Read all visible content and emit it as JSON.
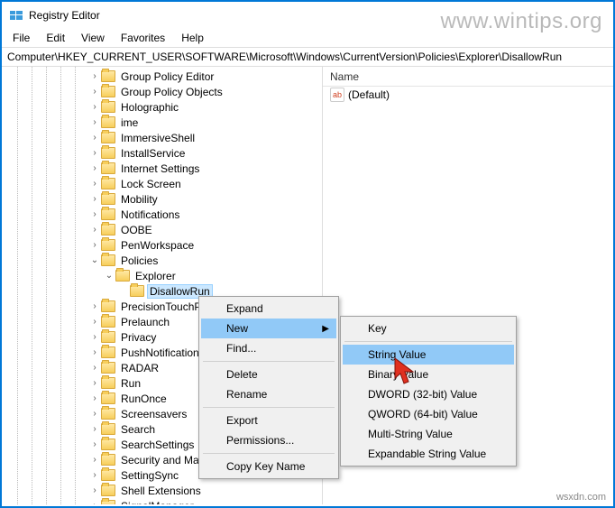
{
  "window": {
    "title": "Registry Editor"
  },
  "menu": {
    "file": "File",
    "edit": "Edit",
    "view": "View",
    "favorites": "Favorites",
    "help": "Help"
  },
  "address": {
    "path": "Computer\\HKEY_CURRENT_USER\\SOFTWARE\\Microsoft\\Windows\\CurrentVersion\\Policies\\Explorer\\DisallowRun"
  },
  "list": {
    "header_name": "Name",
    "default_value": "(Default)"
  },
  "tree": {
    "items": [
      {
        "label": "Group Policy Editor",
        "depth": 6,
        "chev": ">"
      },
      {
        "label": "Group Policy Objects",
        "depth": 6,
        "chev": ">"
      },
      {
        "label": "Holographic",
        "depth": 6,
        "chev": ">"
      },
      {
        "label": "ime",
        "depth": 6,
        "chev": ">"
      },
      {
        "label": "ImmersiveShell",
        "depth": 6,
        "chev": ">"
      },
      {
        "label": "InstallService",
        "depth": 6,
        "chev": ">"
      },
      {
        "label": "Internet Settings",
        "depth": 6,
        "chev": ">"
      },
      {
        "label": "Lock Screen",
        "depth": 6,
        "chev": ">"
      },
      {
        "label": "Mobility",
        "depth": 6,
        "chev": ">"
      },
      {
        "label": "Notifications",
        "depth": 6,
        "chev": ">"
      },
      {
        "label": "OOBE",
        "depth": 6,
        "chev": ">"
      },
      {
        "label": "PenWorkspace",
        "depth": 6,
        "chev": ">"
      },
      {
        "label": "Policies",
        "depth": 6,
        "chev": "v"
      },
      {
        "label": "Explorer",
        "depth": 7,
        "chev": "v"
      },
      {
        "label": "DisallowRun",
        "depth": 8,
        "chev": "",
        "selected": true
      },
      {
        "label": "PrecisionTouchPad",
        "depth": 6,
        "chev": ">"
      },
      {
        "label": "Prelaunch",
        "depth": 6,
        "chev": ">"
      },
      {
        "label": "Privacy",
        "depth": 6,
        "chev": ">"
      },
      {
        "label": "PushNotifications",
        "depth": 6,
        "chev": ">"
      },
      {
        "label": "RADAR",
        "depth": 6,
        "chev": ">"
      },
      {
        "label": "Run",
        "depth": 6,
        "chev": ">"
      },
      {
        "label": "RunOnce",
        "depth": 6,
        "chev": ">"
      },
      {
        "label": "Screensavers",
        "depth": 6,
        "chev": ">"
      },
      {
        "label": "Search",
        "depth": 6,
        "chev": ">"
      },
      {
        "label": "SearchSettings",
        "depth": 6,
        "chev": ">"
      },
      {
        "label": "Security and Maintenance",
        "depth": 6,
        "chev": ">"
      },
      {
        "label": "SettingSync",
        "depth": 6,
        "chev": ">"
      },
      {
        "label": "Shell Extensions",
        "depth": 6,
        "chev": ">"
      },
      {
        "label": "SignalManager",
        "depth": 6,
        "chev": ">"
      }
    ]
  },
  "ctx1": {
    "expand": "Expand",
    "new": "New",
    "find": "Find...",
    "delete": "Delete",
    "rename": "Rename",
    "export": "Export",
    "permissions": "Permissions...",
    "copy": "Copy Key Name"
  },
  "ctx2": {
    "key": "Key",
    "string": "String Value",
    "binary": "Binary Value",
    "dword32": "DWORD (32-bit) Value",
    "qword64": "QWORD (64-bit) Value",
    "multi": "Multi-String Value",
    "expand": "Expandable String Value"
  },
  "watermark": "www.wintips.org",
  "watermark2": "wsxdn.com"
}
